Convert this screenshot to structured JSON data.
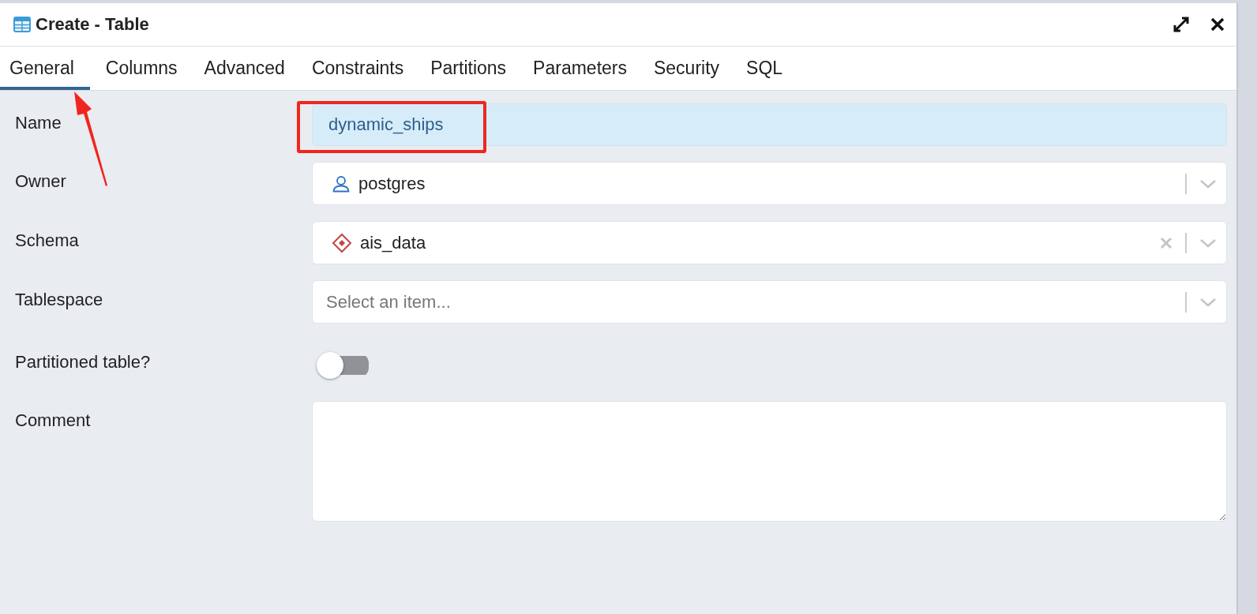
{
  "dialog": {
    "title": "Create - Table"
  },
  "tabs": [
    {
      "label": "General",
      "selected": true
    },
    {
      "label": "Columns",
      "selected": false
    },
    {
      "label": "Advanced",
      "selected": false
    },
    {
      "label": "Constraints",
      "selected": false
    },
    {
      "label": "Partitions",
      "selected": false
    },
    {
      "label": "Parameters",
      "selected": false
    },
    {
      "label": "Security",
      "selected": false
    },
    {
      "label": "SQL",
      "selected": false
    }
  ],
  "fields": [
    {
      "kind": "text",
      "label": "Name",
      "value": "dynamic_ships",
      "highlighted": true
    },
    {
      "kind": "user_select",
      "label": "Owner",
      "value": "postgres",
      "clearable": false
    },
    {
      "kind": "schema_select",
      "label": "Schema",
      "value": "ais_data",
      "clearable": true
    },
    {
      "kind": "select",
      "label": "Tablespace",
      "placeholder": "Select an item...",
      "clearable": false
    },
    {
      "kind": "toggle",
      "label": "Partitioned table?",
      "on": false
    },
    {
      "kind": "textarea",
      "label": "Comment"
    }
  ]
}
